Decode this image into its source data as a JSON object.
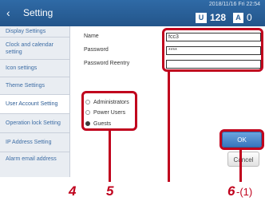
{
  "header": {
    "title": "Setting",
    "back_glyph": "‹",
    "datetime": "2018/11/16 Fri 22:54",
    "count_icon_glyph": "U",
    "count": "128",
    "alert_icon_glyph": "A",
    "alert_count": "0"
  },
  "sidebar": {
    "items": [
      {
        "label": "Display Settings"
      },
      {
        "label": "Clock and calendar setting"
      },
      {
        "label": "Icon settings"
      },
      {
        "label": "Theme Settings"
      },
      {
        "label": "User Account Setting"
      },
      {
        "label": "Operation lock Setting"
      },
      {
        "label": "IP Address Setting"
      },
      {
        "label": "Alarm email address"
      }
    ]
  },
  "form": {
    "name_label": "Name",
    "name_value": "fcc3",
    "password_label": "Password",
    "password_value": "****",
    "reentry_label": "Password Reentry",
    "reentry_value": ""
  },
  "roles": {
    "options": [
      {
        "label": "Administrators",
        "checked": false
      },
      {
        "label": "Power Users",
        "checked": false
      },
      {
        "label": "Guests",
        "checked": true
      }
    ]
  },
  "buttons": {
    "ok": "OK",
    "cancel": "Cancel"
  },
  "annotations": {
    "n4": "4",
    "n5": "5",
    "n6": "6",
    "n6_sub": "-(1)",
    "color": "#c0021d"
  }
}
